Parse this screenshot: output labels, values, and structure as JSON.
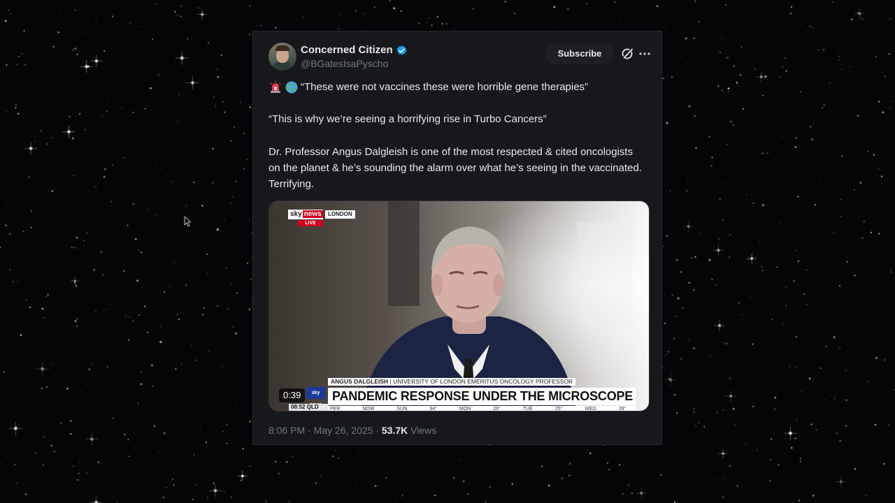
{
  "post": {
    "author_name": "Concerned Citizen",
    "handle": "@BGatesIsaPyscho",
    "subscribe_label": "Subscribe",
    "paragraph_1": "“These were not vaccines these were horrible gene therapies”",
    "paragraph_2": "“This is why we’re seeing a horrifying rise in Turbo Cancers”",
    "paragraph_3": "Dr. Professor Angus Dalgleish is one of the most respected & cited oncologists on the planet & he’s sounding the alarm over what he’s seeing in the vaccinated.  Terrifying.",
    "time": "8:06 PM",
    "separator": "·",
    "date": "May 26, 2025",
    "views_count": "53.7K",
    "views_label": "Views"
  },
  "video": {
    "duration": "0:39",
    "logo_sky": "sky",
    "logo_news": "news",
    "location": "LONDON",
    "live": "LIVE",
    "caption_name": "ANGUS DALGLEISH",
    "caption_title": "UNIVERSITY OF LONDON EMERITUS ONCOLOGY PROFESSOR",
    "headline": "PANDEMIC RESPONSE UNDER THE MICROSCOPE",
    "mini_logo": "sky news",
    "clock": "08:52",
    "clock_region": "QLD",
    "ticker": [
      "PER",
      "NOW",
      "SUN",
      "34°",
      "MON",
      "26°",
      "TUE",
      "25°",
      "WED",
      "28°"
    ]
  },
  "icons": {
    "verified": "verified-badge-icon",
    "grok": "grok-icon",
    "more": "more-icon",
    "siren": "siren-emoji-icon",
    "globe": "globe-emoji-icon",
    "cursor": "mouse-cursor-icon"
  },
  "colors": {
    "card_bg": "#16181c",
    "text": "#e7e9ea",
    "muted": "#71767b",
    "verified": "#1d9bf0",
    "sky_red": "#d2001d",
    "background": "#050507"
  }
}
